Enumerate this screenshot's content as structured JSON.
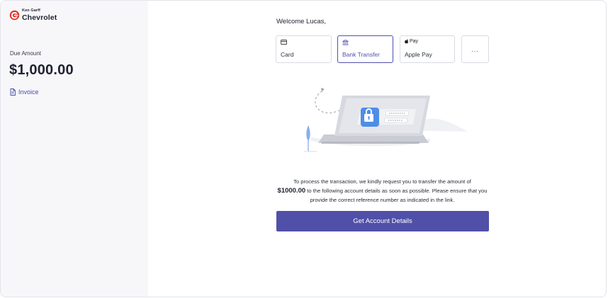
{
  "brand": {
    "name_small": "Ken Garff",
    "name_big": "Chevrolet",
    "accent_color": "#e23124"
  },
  "sidebar": {
    "due_label": "Due Amount",
    "due_amount": "$1,000.00",
    "invoice_label": "Invoice"
  },
  "main": {
    "welcome": "Welcome Lucas,",
    "tabs": [
      {
        "label": "Card",
        "icon": "card-icon"
      },
      {
        "label": "Bank Transfer",
        "icon": "bank-icon",
        "active": true
      },
      {
        "label": "Apple Pay",
        "icon": "apple-pay-icon",
        "icon_text": "Pay"
      },
      {
        "label": "...",
        "icon": "more-icon"
      }
    ],
    "illustration": {
      "icon": "laptop-lock-illustration"
    },
    "message": {
      "before": "To process the transaction, we kindly request you to transfer the amount of",
      "amount": "$1000.00",
      "after": "to the following account details as soon as possible. Please ensure that you provide the correct reference number as indicated in the link."
    },
    "cta_label": "Get Account Details",
    "primary_color": "#5050a8"
  }
}
